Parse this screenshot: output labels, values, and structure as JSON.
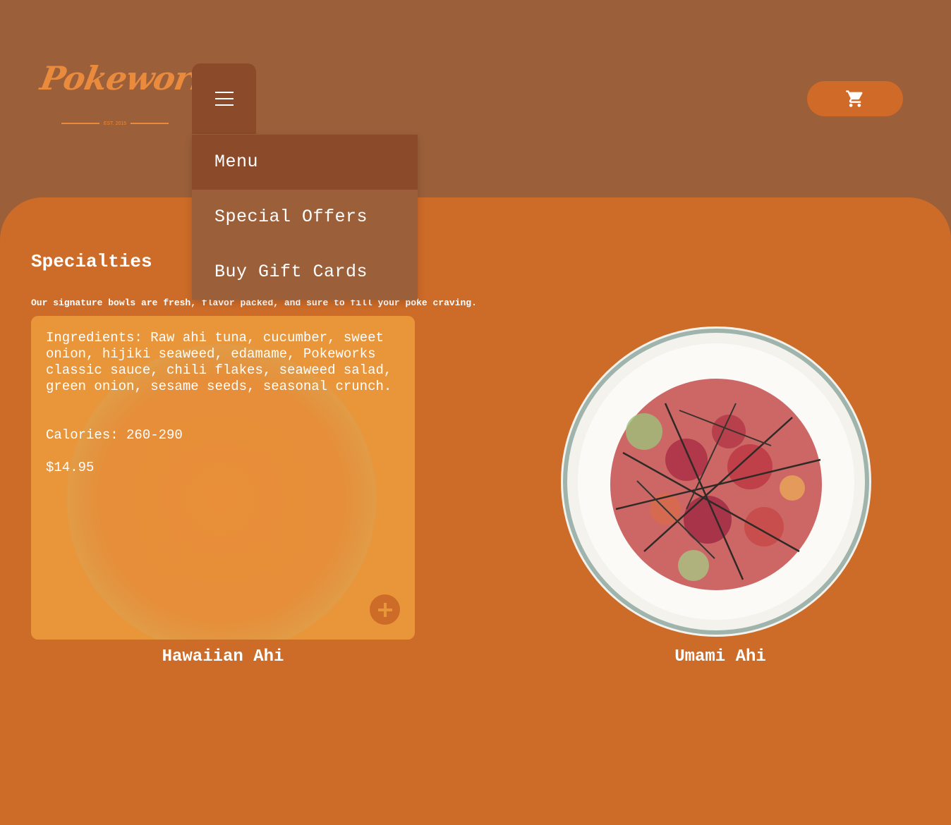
{
  "header": {
    "logo_text": "Pokeworks",
    "logo_est": "EST. 2015",
    "menu_button_icon": "hamburger-icon",
    "cart_icon": "cart-icon"
  },
  "nav_menu": {
    "items": [
      {
        "label": "Menu",
        "active": true
      },
      {
        "label": "Special Offers",
        "active": false
      },
      {
        "label": "Buy Gift Cards",
        "active": false
      }
    ]
  },
  "section": {
    "title": "Specialties",
    "subtitle": "Our signature bowls are fresh, flavor packed, and sure to fill your poke craving."
  },
  "products": [
    {
      "name": "Hawaiian Ahi",
      "ingredients": "Ingredients: Raw ahi tuna, cucumber, sweet onion, hijiki seaweed, edamame, Pokeworks classic sauce, chili flakes, seaweed salad, green onion, sesame seeds, seasonal crunch.",
      "calories": "Calories: 260-290",
      "price": "$14.95",
      "add_icon": "plus-icon"
    },
    {
      "name": "Umami Ahi"
    }
  ],
  "colors": {
    "header_bg": "#9b5f3a",
    "content_bg": "#cd6b28",
    "card_bg": "#e9953a",
    "menu_active": "#8b4a29",
    "logo": "#e98a3c"
  }
}
